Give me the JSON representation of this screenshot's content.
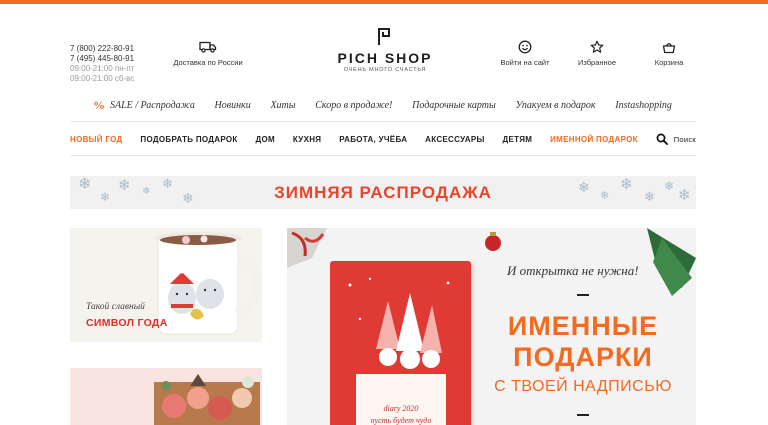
{
  "header": {
    "phones": [
      "7 (800) 222-80-91",
      "7 (495) 445-80-91"
    ],
    "hours": [
      "09:00-21:00 пн-пт",
      "09:00-21:00 сб-вс"
    ],
    "delivery_label": "Доставка по России",
    "logo_brand": "PICH SHOP",
    "logo_tagline": "ОЧЕНЬ МНОГО СЧАСТЬЯ",
    "login_label": "Войти на сайт",
    "favorites_label": "Избранное",
    "cart_label": "Корзина"
  },
  "nav_secondary": {
    "sale_icon": "%",
    "items": [
      "SALE / Распродажа",
      "Новинки",
      "Хиты",
      "Скоро в продаже!",
      "Подарочные карты",
      "Упакуем в подарок",
      "Instashopping"
    ]
  },
  "nav_main": {
    "items": [
      "НОВЫЙ ГОД",
      "ПОДОБРАТЬ ПОДАРОК",
      "ДОМ",
      "КУХНЯ",
      "РАБОТА, УЧЁБА",
      "АКСЕССУАРЫ",
      "ДЕТЯМ",
      "ИМЕННОЙ ПОДАРОК"
    ],
    "search_label": "Поиск"
  },
  "banner": {
    "title": "ЗИМНЯЯ РАСПРОДАЖА"
  },
  "tile_symbol": {
    "line1": "Такой славный",
    "line2": "СИМВОЛ ГОДА"
  },
  "promo": {
    "note": "И открытка не нужна!",
    "line1": "ИМЕННЫЕ",
    "line2": "ПОДАРКИ",
    "line3": "С ТВОЕЙ НАДПИСЬЮ",
    "book_line1": "diary 2020",
    "book_line2": "пусть будет чудо"
  },
  "colors": {
    "accent": "#f26b21",
    "red": "#e8452c",
    "banner_bg": "#f1f1f1"
  }
}
